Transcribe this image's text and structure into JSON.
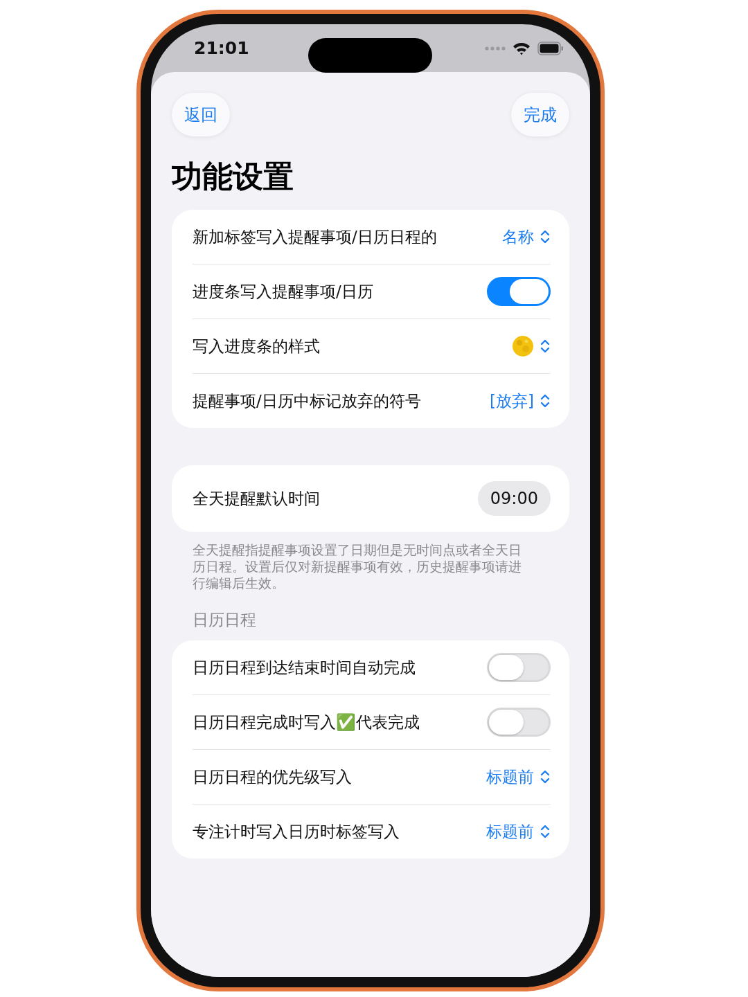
{
  "status_bar": {
    "time": "21:01"
  },
  "nav": {
    "back": "返回",
    "done": "完成"
  },
  "title": "功能设置",
  "groups": [
    {
      "rows": [
        {
          "kind": "picker",
          "label": "新加标签写入提醒事项/日历日程的",
          "value": "名称"
        },
        {
          "kind": "toggle",
          "label": "进度条写入提醒事项/日历",
          "on": true
        },
        {
          "kind": "icon_picker",
          "label": "写入进度条的样式"
        },
        {
          "kind": "picker",
          "label": "提醒事项/日历中标记放弃的符号",
          "value": "[放弃]"
        }
      ]
    },
    {
      "rows": [
        {
          "kind": "time",
          "label": "全天提醒默认时间",
          "value": "09:00"
        }
      ],
      "footer": "全天提醒指提醒事项设置了日期但是无时间点或者全天日历日程。设置后仅对新提醒事项有效，历史提醒事项请进行编辑后生效。"
    },
    {
      "header": "日历日程",
      "rows": [
        {
          "kind": "toggle",
          "label": "日历日程到达结束时间自动完成",
          "on": false
        },
        {
          "kind": "toggle",
          "label": "日历日程完成时写入✅代表完成",
          "on": false
        },
        {
          "kind": "picker",
          "label": "日历日程的优先级写入",
          "value": "标题前"
        },
        {
          "kind": "picker",
          "label": "专注计时写入日历时标签写入",
          "value": "标题前"
        }
      ]
    }
  ]
}
